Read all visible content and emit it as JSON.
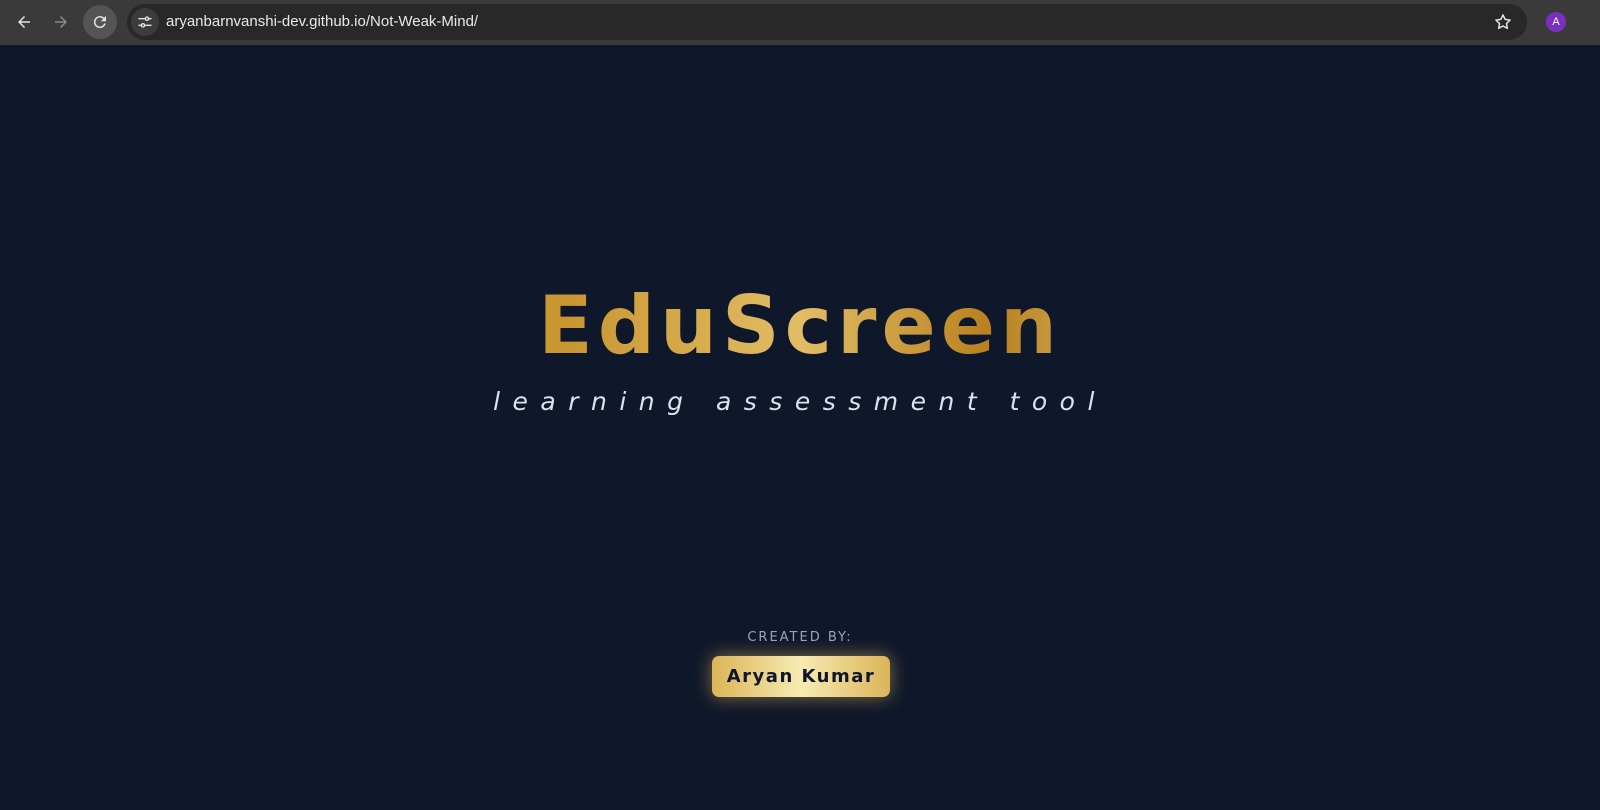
{
  "browser": {
    "url": "aryanbarnvanshi-dev.github.io/Not-Weak-Mind/",
    "profile_initial": "A",
    "profile_color": "#7b2fbf",
    "icons": {
      "back": "arrow-left-icon",
      "forward": "arrow-right-icon",
      "reload": "reload-icon",
      "site_info": "tune-icon",
      "bookmark": "star-icon"
    }
  },
  "hero": {
    "title": "EduScreen",
    "subtitle": "learning assessment tool"
  },
  "credits": {
    "label": "CREATED BY:",
    "author": "Aryan Kumar"
  },
  "colors": {
    "background": "#0f172a",
    "gold_light": "#f3dc96",
    "gold_dark": "#b8801e",
    "subtitle_text": "#dde3ec",
    "label_text": "#9aa5b8",
    "badge_text": "#10162a"
  }
}
